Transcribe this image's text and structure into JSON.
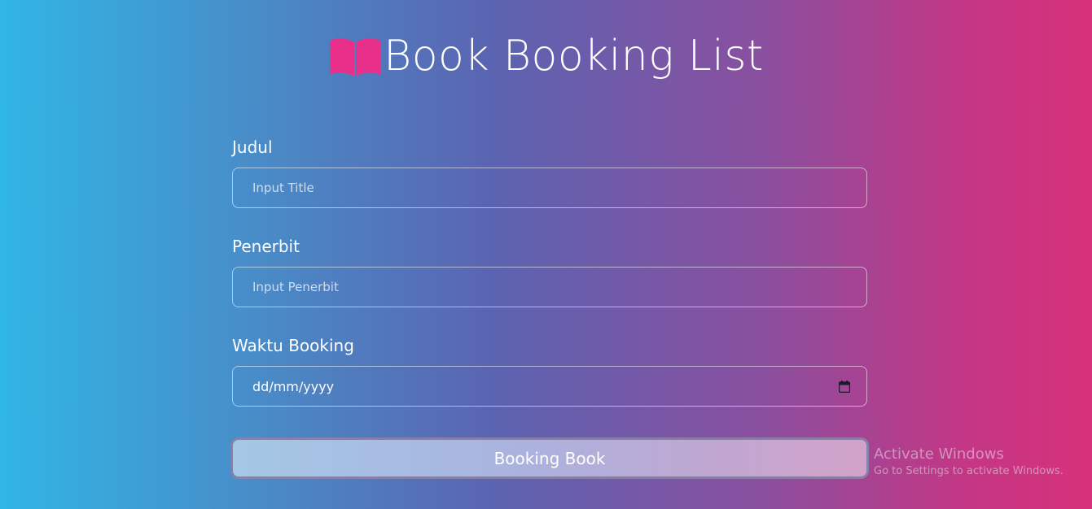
{
  "header": {
    "title": "Book Booking List",
    "icon": "open-book-icon",
    "icon_color": "#e8308a"
  },
  "form": {
    "fields": [
      {
        "label": "Judul",
        "placeholder": "Input Title"
      },
      {
        "label": "Penerbit",
        "placeholder": "Input Penerbit"
      },
      {
        "label": "Waktu Booking",
        "placeholder": "dd/mm/yyyy",
        "icon": "calendar-icon"
      }
    ],
    "submit_label": "Booking Book"
  },
  "watermark": {
    "title": "Activate Windows",
    "subtitle": "Go to Settings to activate Windows."
  },
  "colors": {
    "gradient_start": "#30b6e5",
    "gradient_mid": "#5b64b1",
    "gradient_end": "#d8317a"
  }
}
